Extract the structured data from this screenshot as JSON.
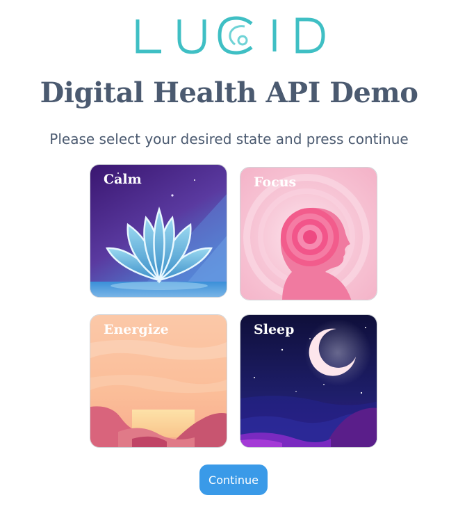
{
  "brand": {
    "logo_text": "LUCID",
    "logo_color": "#3fbfc4"
  },
  "header": {
    "title": "Digital Health API Demo",
    "subtitle": "Please select your desired state and press continue"
  },
  "states": [
    {
      "label": "Calm",
      "icon": "lotus-icon"
    },
    {
      "label": "Focus",
      "icon": "head-target-icon"
    },
    {
      "label": "Energize",
      "icon": "sunset-mountains-icon"
    },
    {
      "label": "Sleep",
      "icon": "crescent-moon-icon"
    }
  ],
  "actions": {
    "continue_label": "Continue",
    "continue_color": "#3a9ae8"
  }
}
